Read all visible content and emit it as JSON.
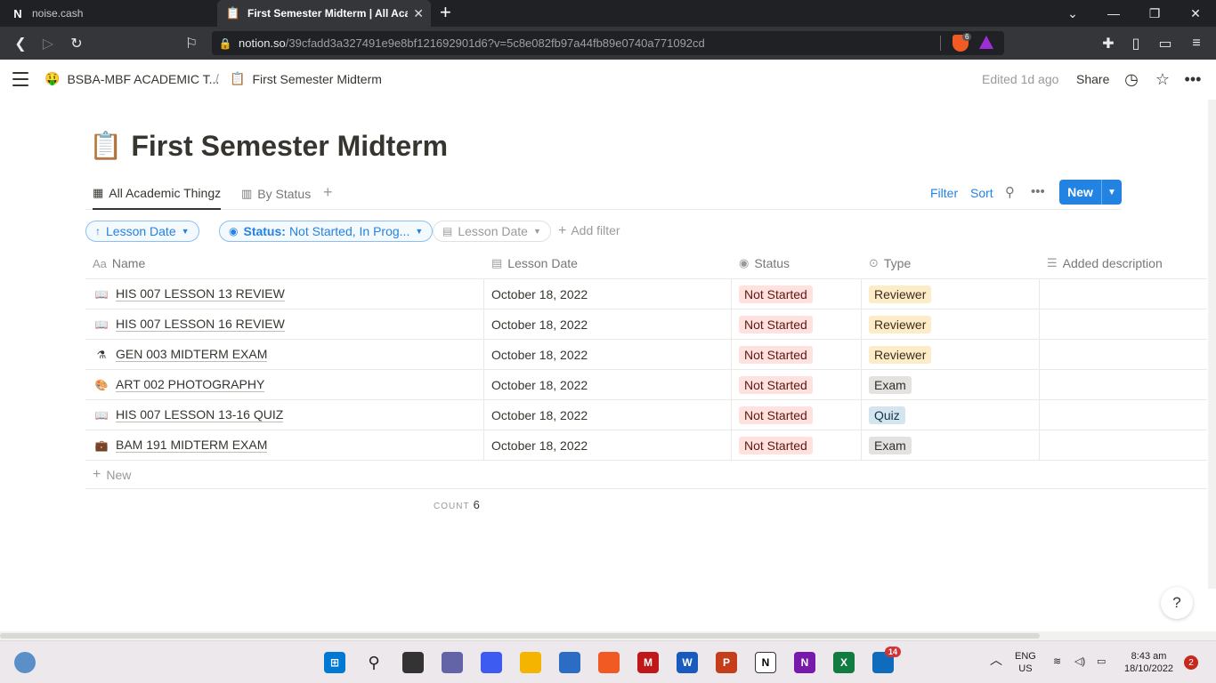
{
  "browser": {
    "tabs": [
      {
        "label": "noise.cash",
        "favicon": "N"
      },
      {
        "label": "First Semester Midterm | All Acad",
        "favicon": "📋"
      }
    ],
    "url_prefix": "notion.so",
    "url_rest": "/39cfadd3a327491e9e8bf121692901d6?v=5c8e082fb97a44fb89e0740a771092cd",
    "brave_count": "6"
  },
  "topbar": {
    "workspace": "BSBA-MBF ACADEMIC T...",
    "workspace_icon": "🤑",
    "separator": "/",
    "page_icon": "📋",
    "page": "First Semester Midterm",
    "edited": "Edited 1d ago",
    "share": "Share"
  },
  "page": {
    "emoji": "📋",
    "title": "First Semester Midterm"
  },
  "views": {
    "tabs": [
      {
        "label": "All Academic Thingz",
        "icon": "table-icon"
      },
      {
        "label": "By Status",
        "icon": "board-icon"
      }
    ],
    "filter": "Filter",
    "sort": "Sort",
    "new": "New"
  },
  "filters": {
    "sort_chip": "Lesson Date",
    "status_prefix": "Status:",
    "status_value": "Not Started, In Prog...",
    "date_chip": "Lesson Date",
    "add_filter": "Add filter"
  },
  "table": {
    "columns": [
      "Name",
      "Lesson Date",
      "Status",
      "Type",
      "Added description"
    ],
    "column_icons": [
      "Aa",
      "calendar-icon",
      "status-icon",
      "select-icon",
      "text-icon"
    ],
    "rows": [
      {
        "icon": "📖",
        "name": "HIS 007 LESSON 13 REVIEW",
        "date": "October 18, 2022",
        "status": "Not Started",
        "type": "Reviewer",
        "type_color": "yellow"
      },
      {
        "icon": "📖",
        "name": "HIS 007 LESSON 16 REVIEW",
        "date": "October 18, 2022",
        "status": "Not Started",
        "type": "Reviewer",
        "type_color": "yellow"
      },
      {
        "icon": "⚗",
        "name": "GEN 003 MIDTERM EXAM",
        "date": "October 18, 2022",
        "status": "Not Started",
        "type": "Reviewer",
        "type_color": "yellow"
      },
      {
        "icon": "🎨",
        "name": "ART 002 PHOTOGRAPHY",
        "date": "October 18, 2022",
        "status": "Not Started",
        "type": "Exam",
        "type_color": "gray"
      },
      {
        "icon": "📖",
        "name": "HIS 007 LESSON 13-16 QUIZ",
        "date": "October 18, 2022",
        "status": "Not Started",
        "type": "Quiz",
        "type_color": "blue"
      },
      {
        "icon": "💼",
        "name": "BAM 191 MIDTERM EXAM",
        "date": "October 18, 2022",
        "status": "Not Started",
        "type": "Exam",
        "type_color": "gray"
      }
    ],
    "new_row": "New",
    "count_label": "COUNT",
    "count_value": "6"
  },
  "help": "?",
  "taskbar": {
    "lang": "ENG",
    "region": "US",
    "time": "8:43 am",
    "date": "18/10/2022",
    "notifications": "2",
    "app_badge": "14"
  },
  "colors": {
    "accent": "#2383e2",
    "status_red": "#ffe2dd",
    "tag_yellow": "#fdecc8",
    "tag_gray": "#e3e2e0",
    "tag_blue": "#d3e5ef"
  }
}
